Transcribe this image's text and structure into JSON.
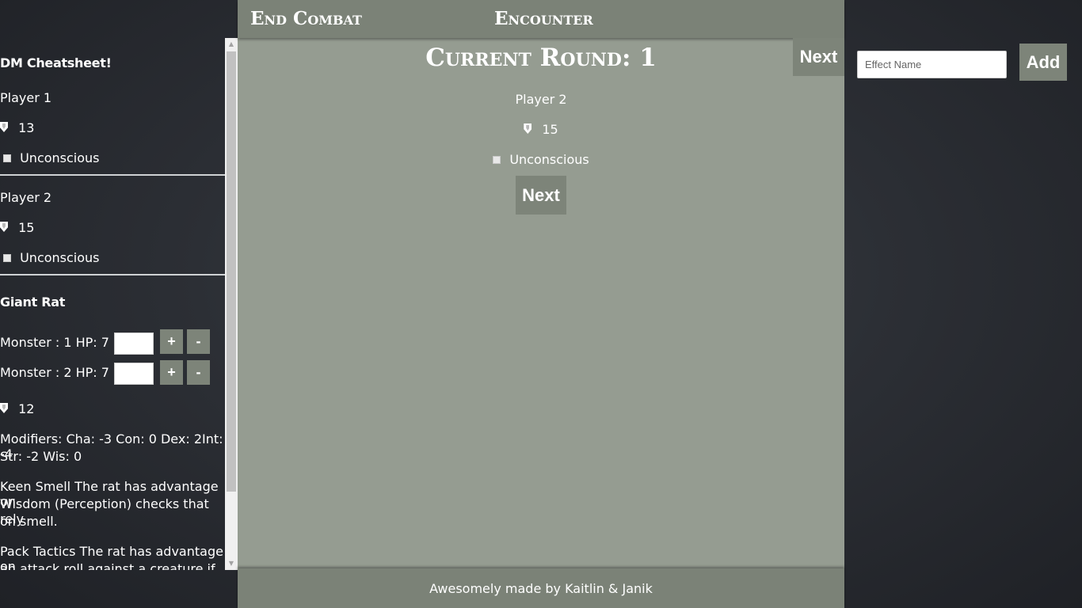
{
  "header": {
    "end_combat": "End Combat",
    "title": "Encounter",
    "next_label": "Next"
  },
  "effects": {
    "placeholder": "Effect Name",
    "add_label": "Add"
  },
  "sidebar": {
    "title": "DM Cheatsheet!",
    "players": [
      {
        "name": "Player 1",
        "ac": "13",
        "condition": "Unconscious"
      },
      {
        "name": "Player 2",
        "ac": "15",
        "condition": "Unconscious"
      }
    ],
    "monster": {
      "name": "Giant Rat",
      "instances": [
        {
          "label": "Monster : 1 HP: 7",
          "plus": "+",
          "minus": "-"
        },
        {
          "label": "Monster : 2 HP: 7",
          "plus": "+",
          "minus": "-"
        }
      ],
      "ac": "12",
      "modifiers_line1": "Modifiers: Cha: -3 Con: 0 Dex: 2Int: -4",
      "modifiers_line2": "Str: -2 Wis: 0",
      "trait1_line1": "Keen Smell The rat has advantage on",
      "trait1_line2": "Wisdom (Perception) checks that rely",
      "trait1_line3": "on smell.",
      "trait2_line1": "Pack Tactics The rat has advantage on",
      "trait2_line2": "an attack roll against a creature if at"
    }
  },
  "main": {
    "round": "Current Round: 1",
    "current_name": "Player 2",
    "current_ac": "15",
    "current_condition": "Unconscious",
    "next_label": "Next"
  },
  "footer": {
    "text": "Awesomely made by Kaitlin & Janik"
  }
}
